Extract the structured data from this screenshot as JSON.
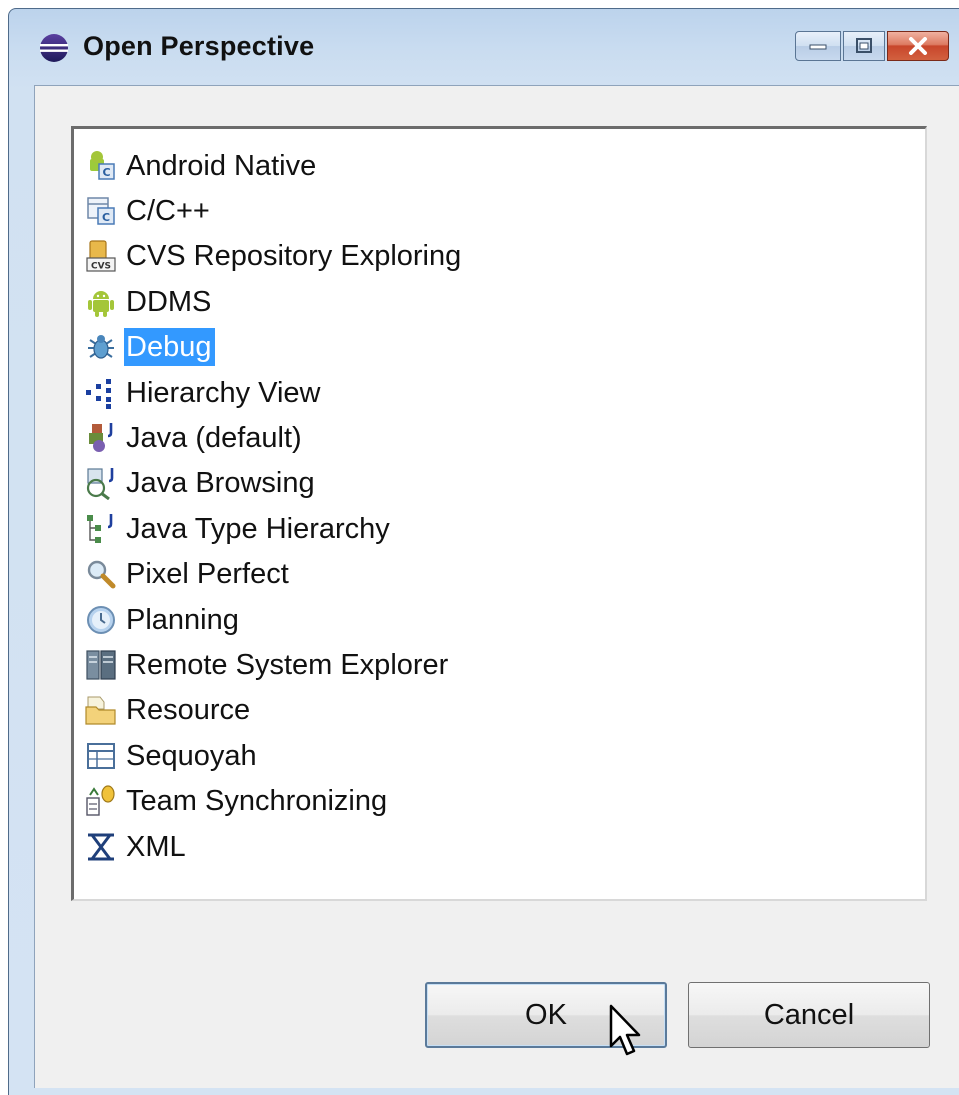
{
  "window": {
    "title": "Open Perspective"
  },
  "perspectives": [
    {
      "label": "Android Native",
      "icon": "android-native-icon"
    },
    {
      "label": "C/C++",
      "icon": "cpp-icon"
    },
    {
      "label": "CVS Repository Exploring",
      "icon": "cvs-icon"
    },
    {
      "label": "DDMS",
      "icon": "android-robot-icon"
    },
    {
      "label": "Debug",
      "icon": "bug-icon",
      "selected": true
    },
    {
      "label": "Hierarchy View",
      "icon": "hierarchy-view-icon"
    },
    {
      "label": "Java (default)",
      "icon": "java-icon"
    },
    {
      "label": "Java Browsing",
      "icon": "java-browsing-icon"
    },
    {
      "label": "Java Type Hierarchy",
      "icon": "java-type-hierarchy-icon"
    },
    {
      "label": "Pixel Perfect",
      "icon": "magnifier-icon"
    },
    {
      "label": "Planning",
      "icon": "clock-icon"
    },
    {
      "label": "Remote System Explorer",
      "icon": "remote-system-icon"
    },
    {
      "label": "Resource",
      "icon": "folder-icon"
    },
    {
      "label": "Sequoyah",
      "icon": "table-icon"
    },
    {
      "label": "Team Synchronizing",
      "icon": "team-sync-icon"
    },
    {
      "label": "XML",
      "icon": "xml-icon"
    }
  ],
  "buttons": {
    "ok_label": "OK",
    "cancel_label": "Cancel"
  },
  "colors": {
    "selection": "#3399ff",
    "title_gradient": "#c9dcf0",
    "dialog_bg": "#f0f0f0"
  }
}
